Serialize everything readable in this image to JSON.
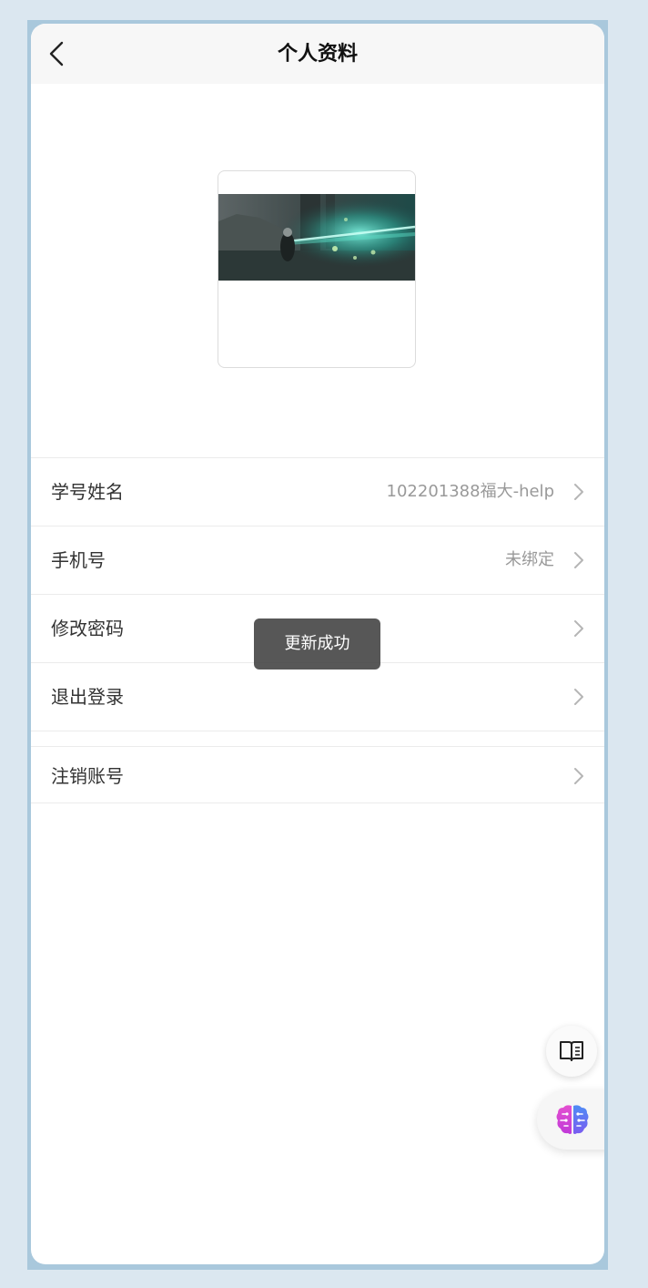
{
  "header": {
    "title": "个人资料"
  },
  "menu": {
    "items": [
      {
        "label": "学号姓名",
        "value": "102201388福大-help"
      },
      {
        "label": "手机号",
        "value": "未绑定"
      },
      {
        "label": "修改密码",
        "value": ""
      },
      {
        "label": "退出登录",
        "value": ""
      }
    ],
    "cancel_account": {
      "label": "注销账号"
    }
  },
  "toast": {
    "message": "更新成功"
  },
  "icons": {
    "back": "chevron-left-icon",
    "row_arrow": "chevron-right-icon",
    "guide": "book-icon",
    "ai": "brain-icon"
  },
  "colors": {
    "background": "#dbe7f0",
    "frame": "#a9c8dc",
    "header": "#f7f7f7",
    "value_text": "#999999",
    "toast_bg": "#404040"
  }
}
